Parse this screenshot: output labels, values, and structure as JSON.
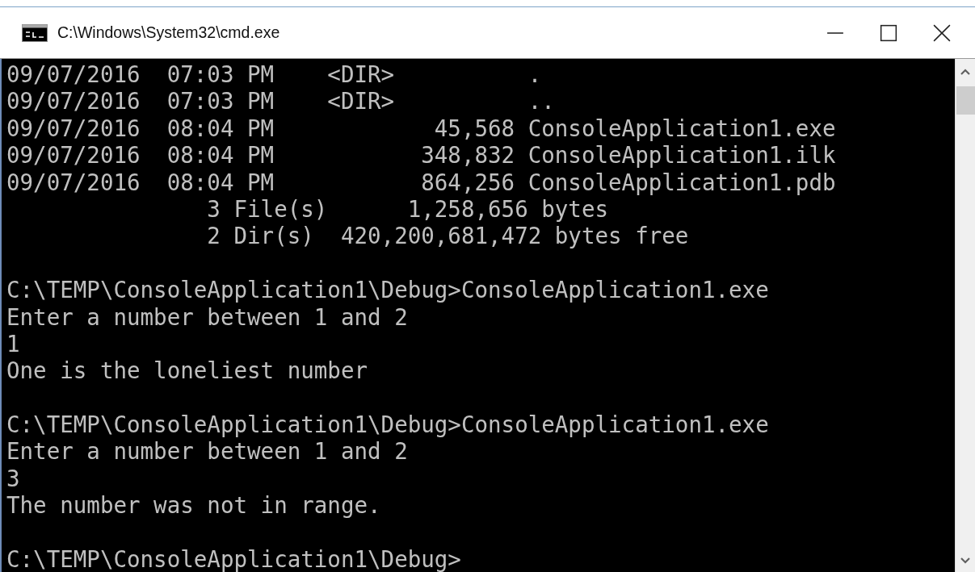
{
  "window": {
    "title": "C:\\Windows\\System32\\cmd.exe"
  },
  "console": {
    "blocks": [
      [
        "09/07/2016  07:03 PM    <DIR>          .",
        "09/07/2016  07:03 PM    <DIR>          ..",
        "09/07/2016  08:04 PM            45,568 ConsoleApplication1.exe",
        "09/07/2016  08:04 PM           348,832 ConsoleApplication1.ilk",
        "09/07/2016  08:04 PM           864,256 ConsoleApplication1.pdb",
        "               3 File(s)      1,258,656 bytes",
        "               2 Dir(s)  420,200,681,472 bytes free"
      ],
      [
        "C:\\TEMP\\ConsoleApplication1\\Debug>ConsoleApplication1.exe",
        "Enter a number between 1 and 2",
        "1",
        "One is the loneliest number"
      ],
      [
        "C:\\TEMP\\ConsoleApplication1\\Debug>ConsoleApplication1.exe",
        "Enter a number between 1 and 2",
        "3",
        "The number was not in range."
      ],
      [
        "C:\\TEMP\\ConsoleApplication1\\Debug>"
      ]
    ]
  }
}
